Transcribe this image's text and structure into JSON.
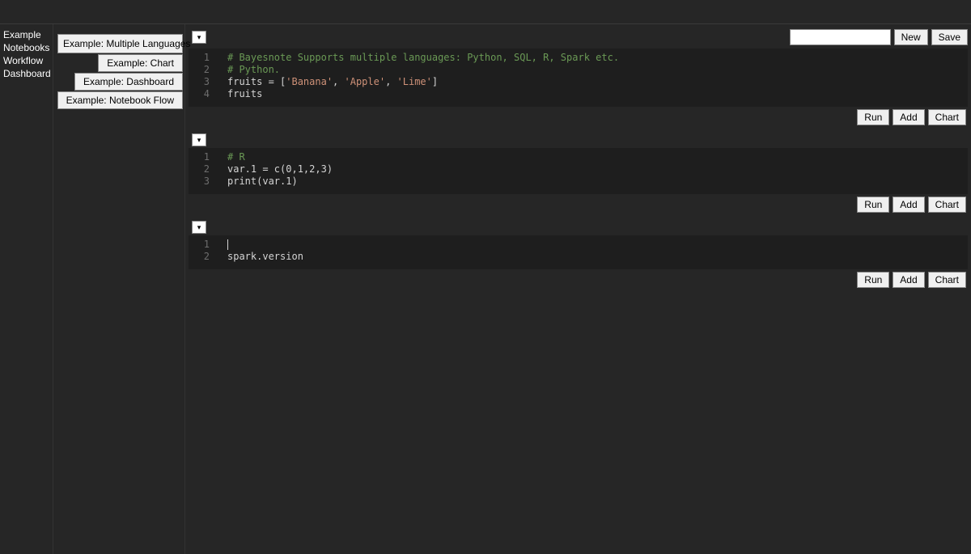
{
  "sidebar_left": {
    "items": [
      "Example",
      "Notebooks",
      "Workflow",
      "Dashboard"
    ]
  },
  "sidebar_mid": {
    "buttons": [
      "Example: Multiple Languages",
      "Example: Chart",
      "Example: Dashboard",
      "Example: Notebook Flow"
    ]
  },
  "toolbar": {
    "name_value": "",
    "new_label": "New",
    "save_label": "Save"
  },
  "cell_buttons": {
    "run": "Run",
    "add": "Add",
    "chart": "Chart"
  },
  "cells": [
    {
      "lines": [
        [
          {
            "cls": "comment",
            "t": "# Bayesnote Supports multiple languages: Python, SQL, R, Spark etc."
          }
        ],
        [
          {
            "cls": "comment",
            "t": "# Python."
          }
        ],
        [
          {
            "cls": "kw",
            "t": "fruits = ["
          },
          {
            "cls": "string",
            "t": "'Banana'"
          },
          {
            "cls": "kw",
            "t": ", "
          },
          {
            "cls": "string",
            "t": "'Apple'"
          },
          {
            "cls": "kw",
            "t": ", "
          },
          {
            "cls": "string",
            "t": "'Lime'"
          },
          {
            "cls": "kw",
            "t": "]"
          }
        ],
        [
          {
            "cls": "kw",
            "t": "fruits"
          }
        ]
      ]
    },
    {
      "lines": [
        [
          {
            "cls": "comment",
            "t": "# R"
          }
        ],
        [
          {
            "cls": "kw",
            "t": "var.1 = c(0,1,2,3)"
          }
        ],
        [
          {
            "cls": "kw",
            "t": "print(var.1)"
          }
        ]
      ]
    },
    {
      "lines": [
        [
          {
            "cls": "cursor",
            "t": ""
          }
        ],
        [
          {
            "cls": "kw",
            "t": "spark.version"
          }
        ]
      ]
    }
  ]
}
